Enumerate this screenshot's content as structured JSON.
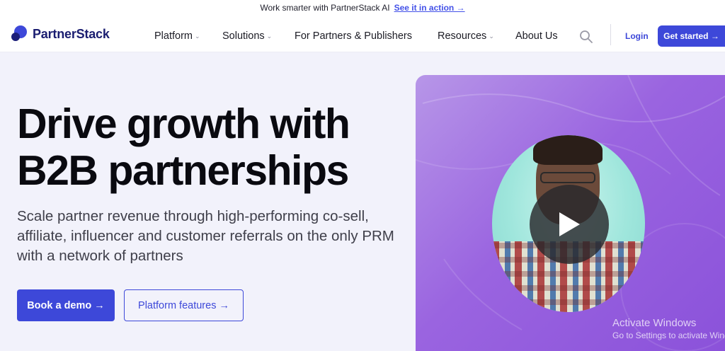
{
  "announcement": {
    "text": "Work smarter with PartnerStack AI",
    "link": "See it in action →"
  },
  "brand": {
    "name": "PartnerStack"
  },
  "nav": {
    "items": [
      {
        "label": "Platform",
        "dropdown": true
      },
      {
        "label": "Solutions",
        "dropdown": true
      },
      {
        "label": "For Partners & Publishers",
        "dropdown": false
      },
      {
        "label": "Resources",
        "dropdown": true
      },
      {
        "label": "About Us",
        "dropdown": false
      }
    ],
    "search_icon": "search-icon",
    "login": "Login",
    "cta": "Get started →"
  },
  "hero": {
    "title": "Drive growth with B2B partnerships",
    "subtitle": "Scale partner revenue through high-performing co-sell, affiliate, influencer and customer referrals on the only PRM with a network of partners",
    "primary_button": "Book a demo →",
    "secondary_button": "Platform features →"
  },
  "video": {
    "play_icon": "play-icon"
  },
  "os_watermark": {
    "line1": "Activate Windows",
    "line2": "Go to Settings to activate Windows."
  },
  "colors": {
    "accent": "#3d48d9",
    "brand_dark": "#1a1d70",
    "page_bg": "#f2f2fb",
    "video_purple": "#9a64e0"
  }
}
